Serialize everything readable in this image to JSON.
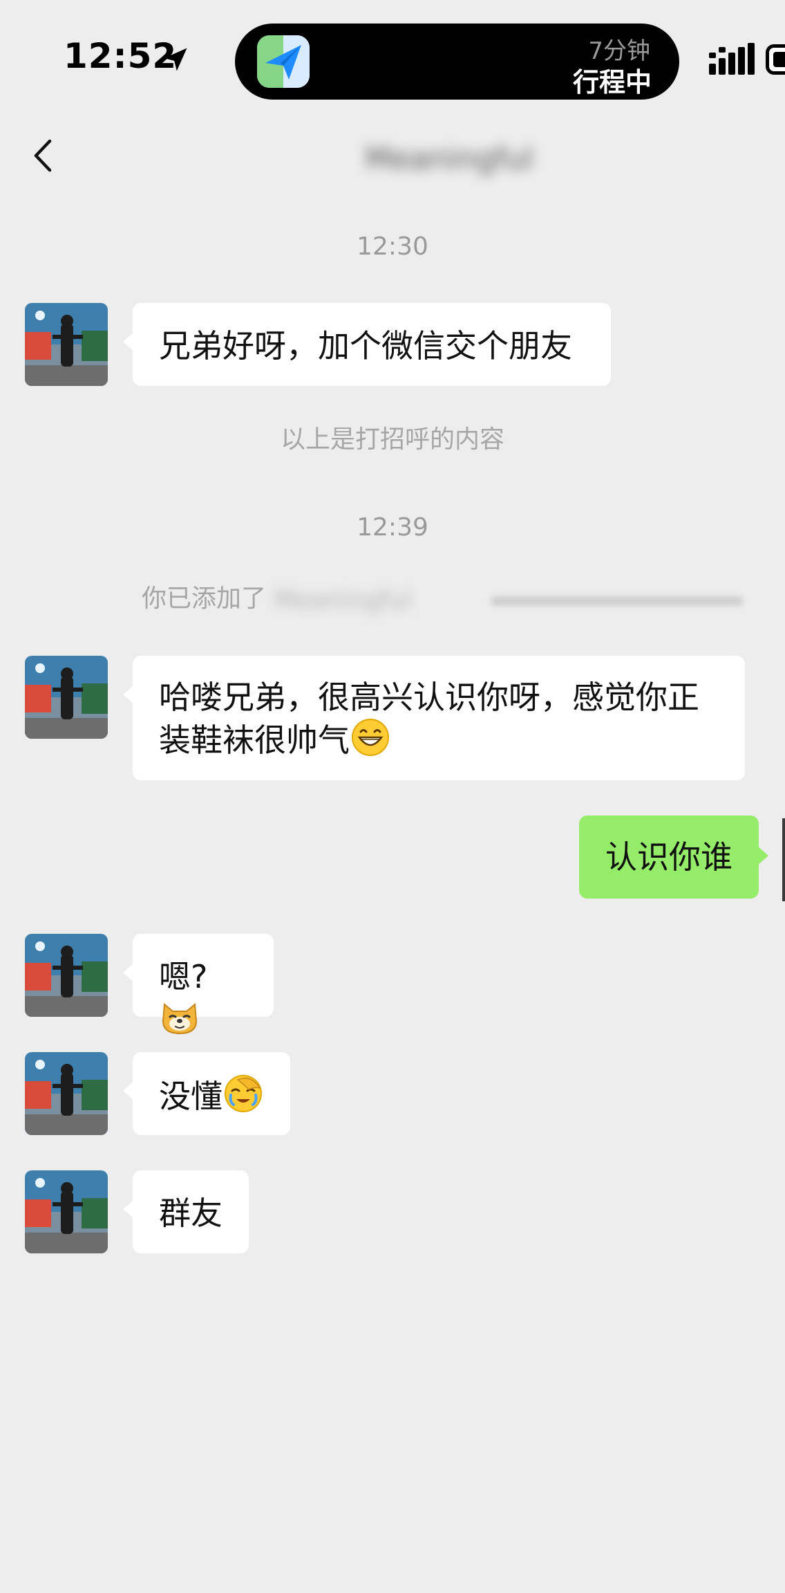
{
  "status_bar": {
    "time": "12:52",
    "island_duration": "7分钟",
    "island_state": "行程中"
  },
  "nav": {
    "title": "Meaningful"
  },
  "messages": {
    "timestamp_1": "12:30",
    "msg_1": "兄弟好呀，加个微信交个朋友",
    "greeting_note": "以上是打招呼的内容",
    "timestamp_2": "12:39",
    "added_prefix": "你已添加了",
    "added_name": "Meaningful",
    "msg_2": "哈喽兄弟，很高兴认识你呀，感觉你正装鞋袜很帅气",
    "msg_3_out": "认识你谁",
    "msg_4": "嗯?",
    "msg_5": "没懂",
    "msg_6": "群友"
  },
  "colors": {
    "background": "#ededed",
    "incoming_bubble": "#ffffff",
    "outgoing_bubble": "#95ec69",
    "meta_text": "#999999"
  },
  "icons": {
    "back": "chevron-left-icon",
    "location": "location-arrow-icon",
    "signal": "signal-icon",
    "battery": "battery-icon",
    "app": "paper-plane-icon"
  }
}
